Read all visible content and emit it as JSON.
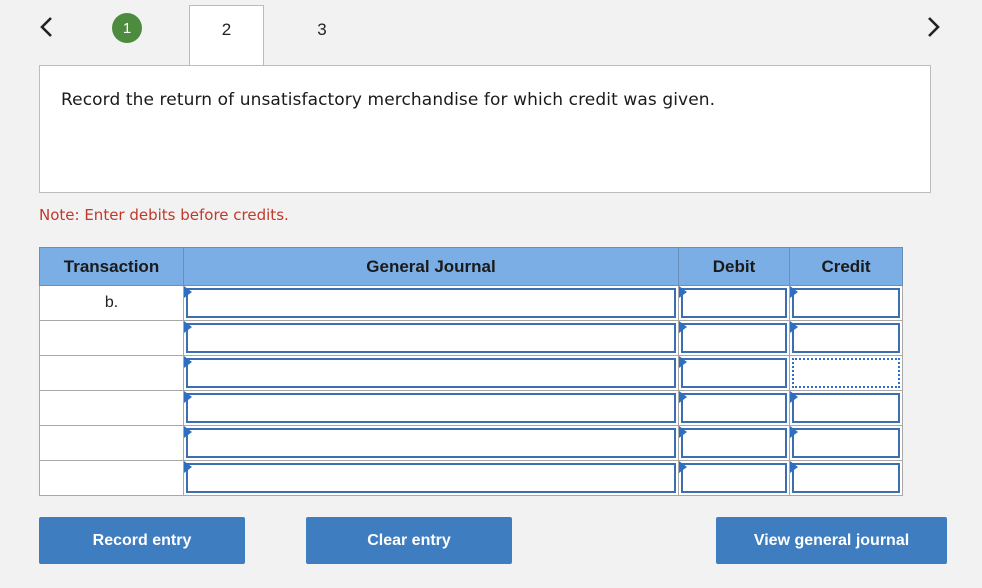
{
  "nav": {
    "prev_icon": "chevron-left-icon",
    "next_icon": "chevron-right-icon",
    "tabs": [
      {
        "label": "1",
        "state": "completed"
      },
      {
        "label": "2",
        "state": "active"
      },
      {
        "label": "3",
        "state": "inactive"
      }
    ]
  },
  "instruction": "Record the return of unsatisfactory merchandise for which credit was given.",
  "note": "Note: Enter debits before credits.",
  "table": {
    "headers": {
      "transaction": "Transaction",
      "general_journal": "General Journal",
      "debit": "Debit",
      "credit": "Credit"
    },
    "rows": [
      {
        "transaction": "b.",
        "general_journal": "",
        "debit": "",
        "credit": ""
      },
      {
        "transaction": "",
        "general_journal": "",
        "debit": "",
        "credit": ""
      },
      {
        "transaction": "",
        "general_journal": "",
        "debit": "",
        "credit": ""
      },
      {
        "transaction": "",
        "general_journal": "",
        "debit": "",
        "credit": ""
      },
      {
        "transaction": "",
        "general_journal": "",
        "debit": "",
        "credit": ""
      },
      {
        "transaction": "",
        "general_journal": "",
        "debit": "",
        "credit": ""
      }
    ]
  },
  "buttons": {
    "record": "Record entry",
    "clear": "Clear entry",
    "view": "View general journal"
  },
  "colors": {
    "header_bg": "#7aaee4",
    "button_bg": "#3f7dc1",
    "completed_tab": "#4d8c3f",
    "note_text": "#c0392b"
  }
}
